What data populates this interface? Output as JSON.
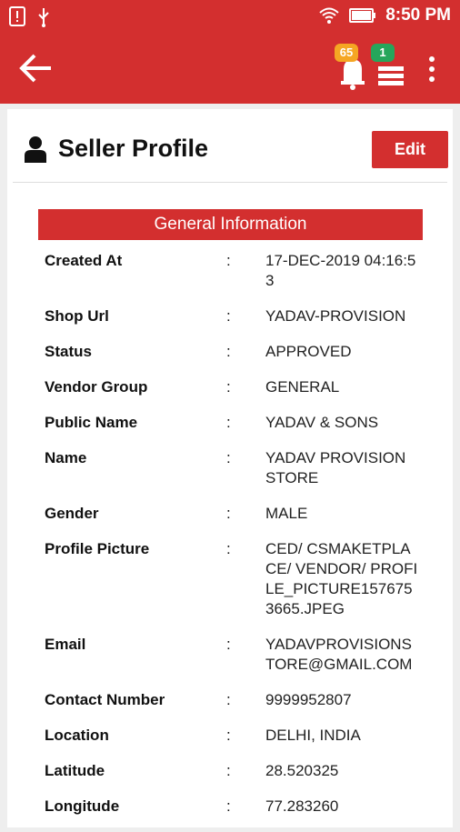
{
  "status_bar": {
    "time": "8:50 PM",
    "icons": [
      "alert-icon",
      "usb-icon",
      "wifi-icon",
      "battery-icon"
    ]
  },
  "app_bar": {
    "notifications_count": "65",
    "list_count": "1",
    "icons": [
      "back-arrow-icon",
      "bell-icon",
      "list-icon",
      "more-vertical-icon"
    ]
  },
  "header": {
    "title": "Seller Profile",
    "edit_label": "Edit"
  },
  "section": {
    "title": "General Information"
  },
  "separator": ":",
  "info_rows": [
    {
      "label": "Created At",
      "value": "17-DEC-2019 04:16:53"
    },
    {
      "label": "Shop Url",
      "value": "YADAV-PROVISION"
    },
    {
      "label": "Status",
      "value": "APPROVED"
    },
    {
      "label": "Vendor Group",
      "value": "GENERAL"
    },
    {
      "label": "Public Name",
      "value": "YADAV & SONS"
    },
    {
      "label": "Name",
      "value": "YADAV PROVISION STORE"
    },
    {
      "label": "Gender",
      "value": "MALE"
    },
    {
      "label": "Profile Picture",
      "value": "CED/ CSMAKETPLACE/ VENDOR/ PROFILE_PICTURE1576753665.JPEG"
    },
    {
      "label": "Email",
      "value": "YADAVPROVISIONSTORE@GMAIL.COM"
    },
    {
      "label": "Contact Number",
      "value": "9999952807"
    },
    {
      "label": "Location",
      "value": "DELHI, INDIA"
    },
    {
      "label": "Latitude",
      "value": "28.520325"
    },
    {
      "label": "Longitude",
      "value": "77.283260"
    }
  ],
  "colors": {
    "primary": "#d32f2f",
    "badge_orange": "#f5a623",
    "badge_green": "#26a65b"
  }
}
